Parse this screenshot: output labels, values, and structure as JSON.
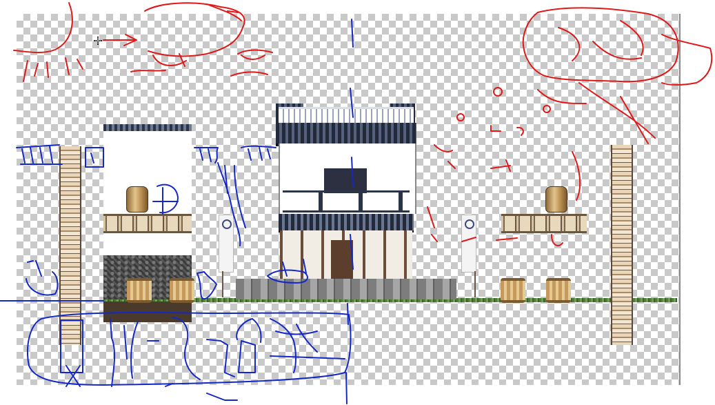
{
  "editor": {
    "canvas": "level-canvas",
    "tool": "pen",
    "ink_colors": {
      "red": "#e01818",
      "blue": "#1428c8"
    }
  },
  "scene": {
    "sprites": [
      "left-pillar",
      "right-pillar",
      "white-warehouse",
      "main-house",
      "grain-sack-left",
      "grain-sack-right",
      "barrels",
      "banners",
      "stone-foundation",
      "grass-ground"
    ]
  },
  "icons": {
    "cursor": "move-cursor-icon"
  }
}
